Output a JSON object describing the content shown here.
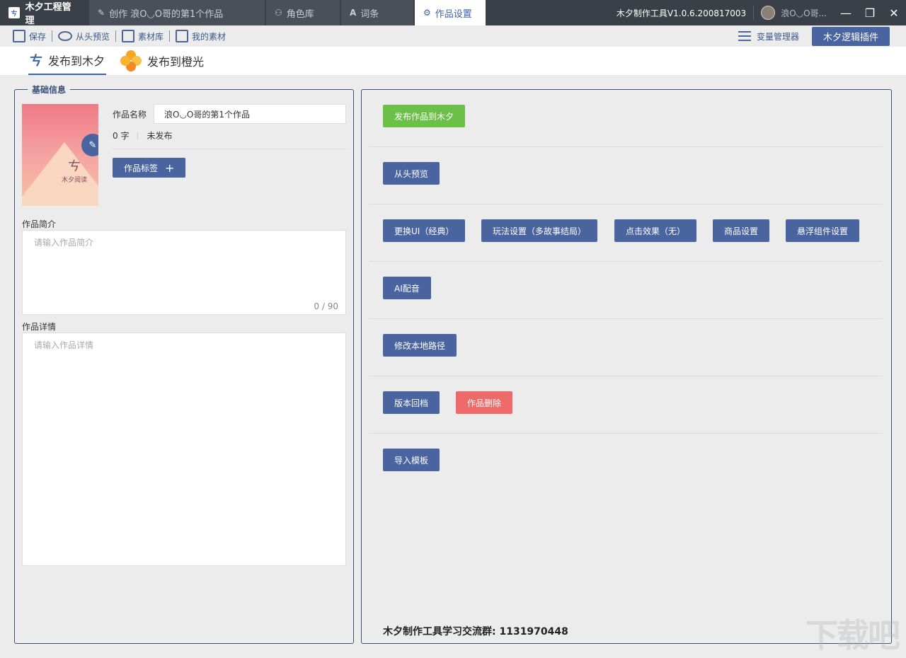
{
  "titlebar": {
    "app_name": "木夕工程管理",
    "app_logo_text": "ㄘ",
    "tabs": [
      {
        "label": "创作 浪O◡O哥的第1个作品",
        "icon": "pencil-icon",
        "glyph": "✎"
      },
      {
        "label": "角色库",
        "icon": "users-icon",
        "glyph": "⚇"
      },
      {
        "label": "词条",
        "icon": "font-icon",
        "glyph": "A"
      },
      {
        "label": "作品设置",
        "icon": "gear-icon",
        "glyph": "⚙"
      }
    ],
    "version": "木夕制作工具V1.0.6.200817003",
    "username": "浪O◡O哥...",
    "minimize": "—",
    "restore": "❐",
    "close": "✕"
  },
  "toolbar": {
    "items": [
      {
        "label": "保存",
        "icon": "save-icon"
      },
      {
        "label": "从头预览",
        "icon": "eye-icon"
      },
      {
        "label": "素材库",
        "icon": "image-library-icon"
      },
      {
        "label": "我的素材",
        "icon": "my-assets-icon"
      }
    ],
    "variable_manager": "变量管理器",
    "logic_plugin": "木夕逻辑插件"
  },
  "publish_tabs": [
    {
      "label": "发布到木夕",
      "icon": "muxi-logo-icon",
      "glyph": "ㄘ",
      "active": true
    },
    {
      "label": "发布到橙光",
      "icon": "chengguang-logo-icon",
      "active": false
    }
  ],
  "basic_info": {
    "legend": "基础信息",
    "cover_title": "ㄘ",
    "cover_subtitle": "木夕阅读",
    "edit_glyph": "✎",
    "name_label": "作品名称",
    "name_value": "浪O◡O哥的第1个作品",
    "word_count": "0 字",
    "publish_status": "未发布",
    "tag_button": "作品标签",
    "tag_plus": "+",
    "intro_label": "作品简介",
    "intro_placeholder": "请输入作品简介",
    "intro_counter": "0 / 90",
    "detail_label": "作品详情",
    "detail_placeholder": "请输入作品详情"
  },
  "actions": {
    "rows": [
      [
        {
          "label": "发布作品到木夕",
          "style": "green"
        }
      ],
      [
        {
          "label": "从头预览",
          "style": "blue"
        }
      ],
      [
        {
          "label": "更换UI（经典）",
          "style": "blue"
        },
        {
          "label": "玩法设置（多故事结局）",
          "style": "blue"
        },
        {
          "label": "点击效果（无）",
          "style": "blue"
        },
        {
          "label": "商品设置",
          "style": "blue"
        },
        {
          "label": "悬浮组件设置",
          "style": "blue"
        }
      ],
      [
        {
          "label": "AI配音",
          "style": "blue"
        }
      ],
      [
        {
          "label": "修改本地路径",
          "style": "blue"
        }
      ],
      [
        {
          "label": "版本回档",
          "style": "blue"
        },
        {
          "label": "作品删除",
          "style": "red"
        }
      ],
      [
        {
          "label": "导入模板",
          "style": "blue"
        }
      ]
    ],
    "footer": "木夕制作工具学习交流群: 1131970448"
  },
  "watermark": "下载吧",
  "colors": {
    "titlebar_bg": "#3a3f48",
    "primary_button": "#4a64a0",
    "green_button": "#6cc048",
    "red_button": "#ee6a6a",
    "panel_border": "#3b4f7a"
  }
}
